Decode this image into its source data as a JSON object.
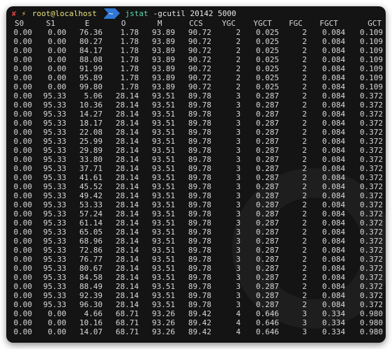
{
  "prompt": {
    "status_icon": "x-mark-icon",
    "bolt_icon": "lightning-icon",
    "user_host": "root@localhost",
    "directory": "~",
    "command": "jstat",
    "arguments": "-gcutil 20142 5000",
    "colors": {
      "error": "#e0443e",
      "bolt": "#f2c94c",
      "user": "#e9e27a",
      "dir_bg": "#2f78d6",
      "command": "#5fd7af",
      "background": "#141414",
      "text": "#d8d8d8"
    }
  },
  "columns": [
    "S0",
    "S1",
    "E",
    "O",
    "M",
    "CCS",
    "YGC",
    "YGCT",
    "FGC",
    "FGCT",
    "GCT"
  ],
  "rows": [
    [
      "0.00",
      "0.00",
      "76.36",
      "1.78",
      "93.89",
      "90.72",
      "2",
      "0.025",
      "2",
      "0.084",
      "0.109"
    ],
    [
      "0.00",
      "0.00",
      "80.27",
      "1.78",
      "93.89",
      "90.72",
      "2",
      "0.025",
      "2",
      "0.084",
      "0.109"
    ],
    [
      "0.00",
      "0.00",
      "84.17",
      "1.78",
      "93.89",
      "90.72",
      "2",
      "0.025",
      "2",
      "0.084",
      "0.109"
    ],
    [
      "0.00",
      "0.00",
      "88.08",
      "1.78",
      "93.89",
      "90.72",
      "2",
      "0.025",
      "2",
      "0.084",
      "0.109"
    ],
    [
      "0.00",
      "0.00",
      "91.99",
      "1.78",
      "93.89",
      "90.72",
      "2",
      "0.025",
      "2",
      "0.084",
      "0.109"
    ],
    [
      "0.00",
      "0.00",
      "95.89",
      "1.78",
      "93.89",
      "90.72",
      "2",
      "0.025",
      "2",
      "0.084",
      "0.109"
    ],
    [
      "0.00",
      "0.00",
      "99.80",
      "1.78",
      "93.89",
      "90.72",
      "2",
      "0.025",
      "2",
      "0.084",
      "0.109"
    ],
    [
      "0.00",
      "95.33",
      "5.06",
      "28.14",
      "93.51",
      "89.78",
      "3",
      "0.287",
      "2",
      "0.084",
      "0.372"
    ],
    [
      "0.00",
      "95.33",
      "10.36",
      "28.14",
      "93.51",
      "89.78",
      "3",
      "0.287",
      "2",
      "0.084",
      "0.372"
    ],
    [
      "0.00",
      "95.33",
      "14.27",
      "28.14",
      "93.51",
      "89.78",
      "3",
      "0.287",
      "2",
      "0.084",
      "0.372"
    ],
    [
      "0.00",
      "95.33",
      "18.17",
      "28.14",
      "93.51",
      "89.78",
      "3",
      "0.287",
      "2",
      "0.084",
      "0.372"
    ],
    [
      "0.00",
      "95.33",
      "22.08",
      "28.14",
      "93.51",
      "89.78",
      "3",
      "0.287",
      "2",
      "0.084",
      "0.372"
    ],
    [
      "0.00",
      "95.33",
      "25.99",
      "28.14",
      "93.51",
      "89.78",
      "3",
      "0.287",
      "2",
      "0.084",
      "0.372"
    ],
    [
      "0.00",
      "95.33",
      "29.89",
      "28.14",
      "93.51",
      "89.78",
      "3",
      "0.287",
      "2",
      "0.084",
      "0.372"
    ],
    [
      "0.00",
      "95.33",
      "33.80",
      "28.14",
      "93.51",
      "89.78",
      "3",
      "0.287",
      "2",
      "0.084",
      "0.372"
    ],
    [
      "0.00",
      "95.33",
      "37.71",
      "28.14",
      "93.51",
      "89.78",
      "3",
      "0.287",
      "2",
      "0.084",
      "0.372"
    ],
    [
      "0.00",
      "95.33",
      "41.61",
      "28.14",
      "93.51",
      "89.78",
      "3",
      "0.287",
      "2",
      "0.084",
      "0.372"
    ],
    [
      "0.00",
      "95.33",
      "45.52",
      "28.14",
      "93.51",
      "89.78",
      "3",
      "0.287",
      "2",
      "0.084",
      "0.372"
    ],
    [
      "0.00",
      "95.33",
      "49.42",
      "28.14",
      "93.51",
      "89.78",
      "3",
      "0.287",
      "2",
      "0.084",
      "0.372"
    ],
    [
      "0.00",
      "95.33",
      "53.33",
      "28.14",
      "93.51",
      "89.78",
      "3",
      "0.287",
      "2",
      "0.084",
      "0.372"
    ],
    [
      "0.00",
      "95.33",
      "57.24",
      "28.14",
      "93.51",
      "89.78",
      "3",
      "0.287",
      "2",
      "0.084",
      "0.372"
    ],
    [
      "0.00",
      "95.33",
      "61.14",
      "28.14",
      "93.51",
      "89.78",
      "3",
      "0.287",
      "2",
      "0.084",
      "0.372"
    ],
    [
      "0.00",
      "95.33",
      "65.05",
      "28.14",
      "93.51",
      "89.78",
      "3",
      "0.287",
      "2",
      "0.084",
      "0.372"
    ],
    [
      "0.00",
      "95.33",
      "68.96",
      "28.14",
      "93.51",
      "89.78",
      "3",
      "0.287",
      "2",
      "0.084",
      "0.372"
    ],
    [
      "0.00",
      "95.33",
      "72.86",
      "28.14",
      "93.51",
      "89.78",
      "3",
      "0.287",
      "2",
      "0.084",
      "0.372"
    ],
    [
      "0.00",
      "95.33",
      "76.77",
      "28.14",
      "93.51",
      "89.78",
      "3",
      "0.287",
      "2",
      "0.084",
      "0.372"
    ],
    [
      "0.00",
      "95.33",
      "80.67",
      "28.14",
      "93.51",
      "89.78",
      "3",
      "0.287",
      "2",
      "0.084",
      "0.372"
    ],
    [
      "0.00",
      "95.33",
      "84.58",
      "28.14",
      "93.51",
      "89.78",
      "3",
      "0.287",
      "2",
      "0.084",
      "0.372"
    ],
    [
      "0.00",
      "95.33",
      "88.49",
      "28.14",
      "93.51",
      "89.78",
      "3",
      "0.287",
      "2",
      "0.084",
      "0.372"
    ],
    [
      "0.00",
      "95.33",
      "92.39",
      "28.14",
      "93.51",
      "89.78",
      "3",
      "0.287",
      "2",
      "0.084",
      "0.372"
    ],
    [
      "0.00",
      "95.33",
      "96.30",
      "28.14",
      "93.51",
      "89.78",
      "3",
      "0.287",
      "2",
      "0.084",
      "0.372"
    ],
    [
      "0.00",
      "0.00",
      "4.66",
      "68.71",
      "93.26",
      "89.42",
      "4",
      "0.646",
      "3",
      "0.334",
      "0.980"
    ],
    [
      "0.00",
      "0.00",
      "10.16",
      "68.71",
      "93.26",
      "89.42",
      "4",
      "0.646",
      "3",
      "0.334",
      "0.980"
    ],
    [
      "0.00",
      "0.00",
      "14.07",
      "68.71",
      "93.26",
      "89.42",
      "4",
      "0.646",
      "3",
      "0.334",
      "0.980"
    ]
  ]
}
